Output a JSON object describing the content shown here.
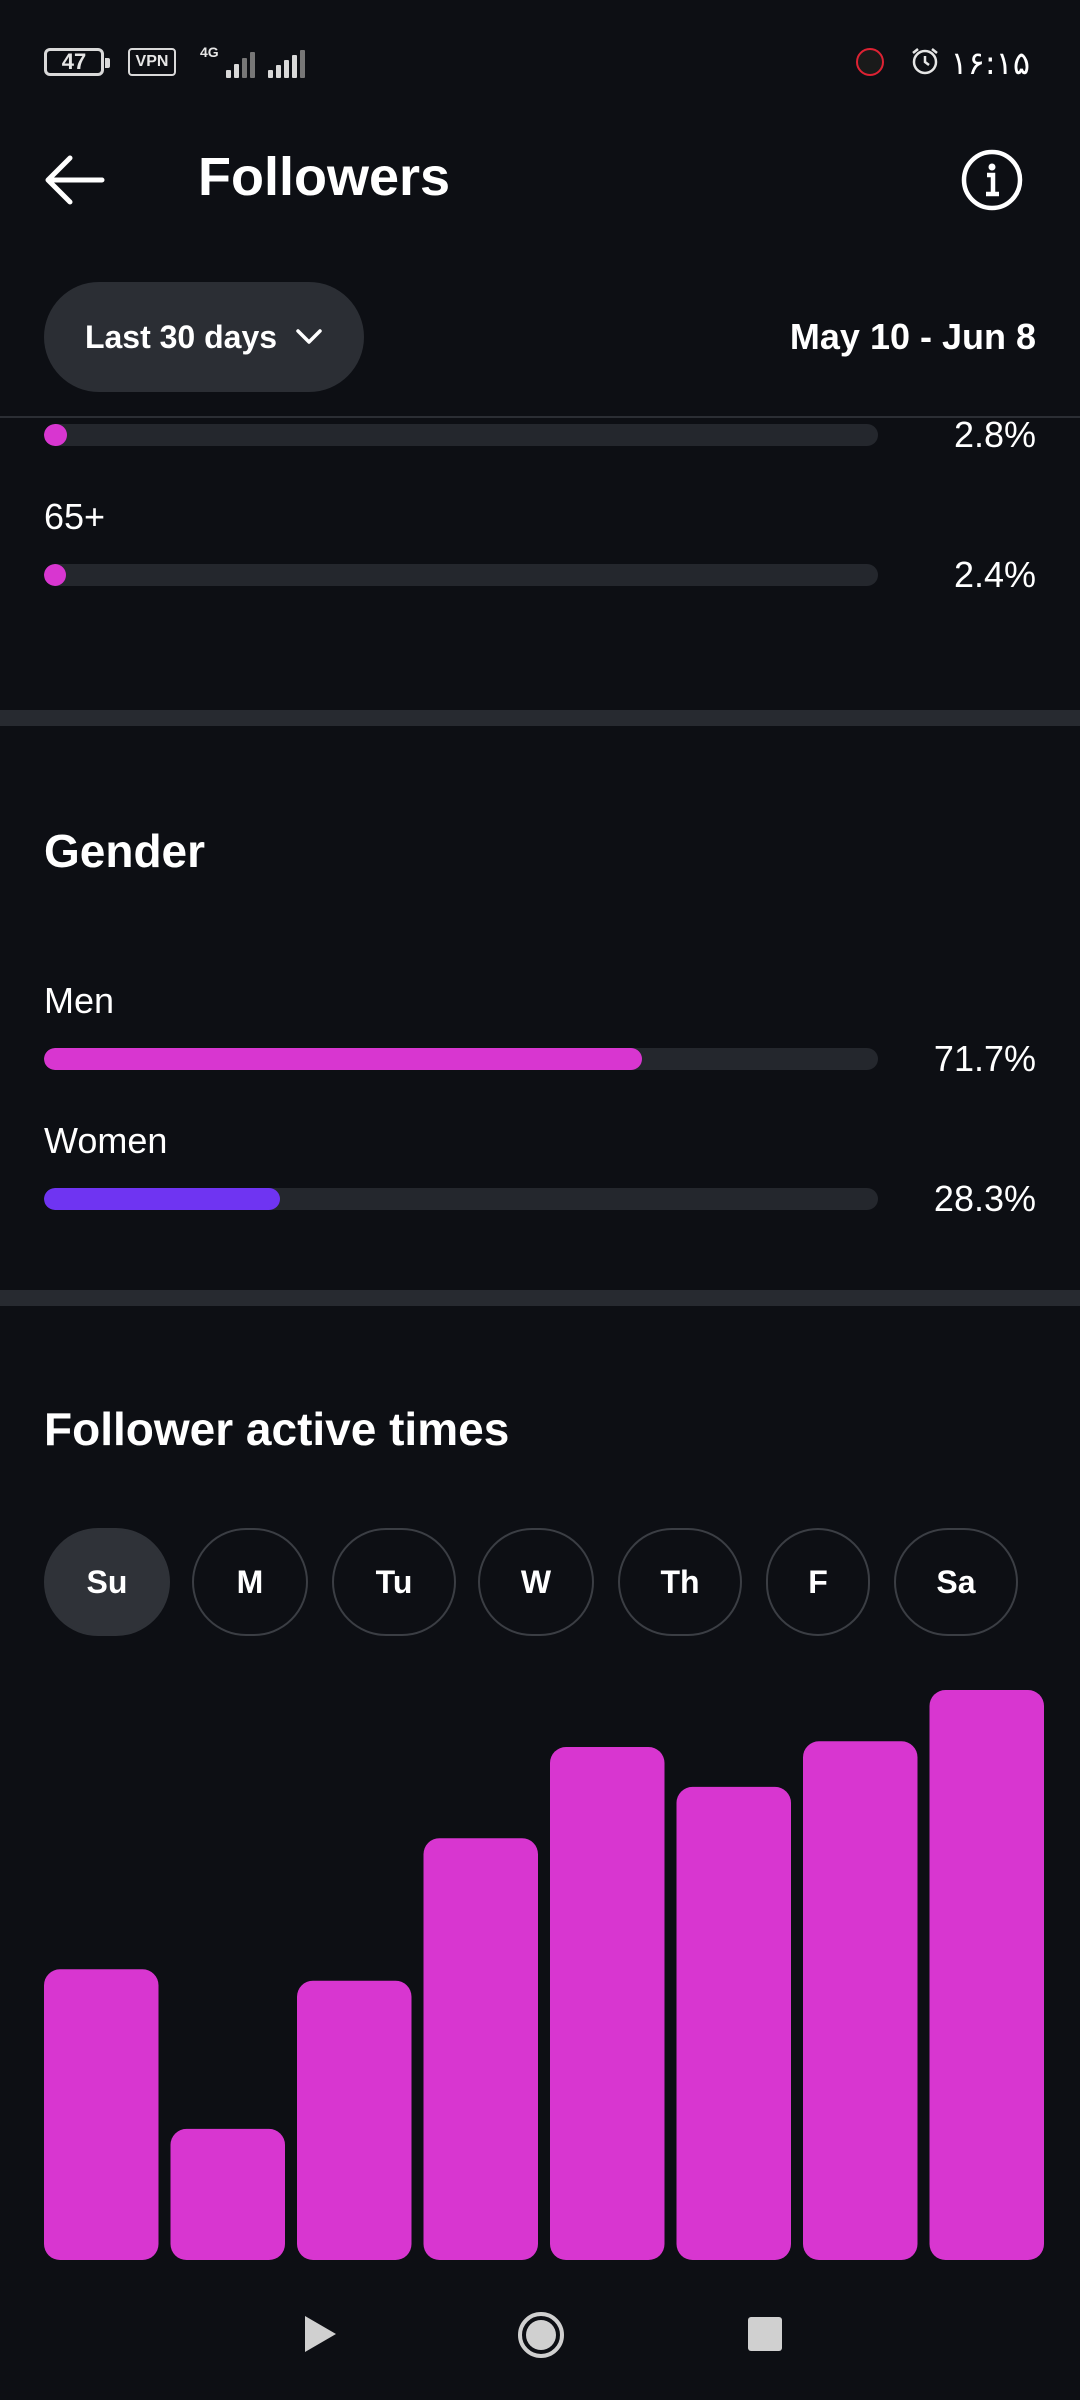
{
  "status_bar": {
    "battery": "47",
    "vpn": "VPN",
    "network": "4G",
    "time": "۱۶:۱۵"
  },
  "header": {
    "title": "Followers"
  },
  "filter": {
    "range_label": "Last 30 days",
    "date_range": "May 10 - Jun 8"
  },
  "age": {
    "rows": [
      {
        "label": "",
        "percent_text": "2.8%",
        "fraction": 0.028
      },
      {
        "label": "65+",
        "percent_text": "2.4%",
        "fraction": 0.024
      }
    ]
  },
  "gender": {
    "title": "Gender",
    "rows": [
      {
        "label": "Men",
        "percent_text": "71.7%",
        "fraction": 0.717,
        "color": "#d836d0"
      },
      {
        "label": "Women",
        "percent_text": "28.3%",
        "fraction": 0.283,
        "color": "#6f34f2"
      }
    ]
  },
  "active_times": {
    "title": "Follower active times",
    "days": [
      "Su",
      "M",
      "Tu",
      "W",
      "Th",
      "F",
      "Sa"
    ],
    "selected_day": "Su"
  },
  "chart_data": {
    "type": "bar",
    "categories": [
      "",
      "",
      "",
      "",
      "",
      "",
      "",
      ""
    ],
    "values": [
      51,
      23,
      49,
      74,
      90,
      83,
      91,
      100
    ],
    "ylim": [
      0,
      100
    ],
    "color": "#d836d0",
    "grid": false
  },
  "colors": {
    "background": "#0d0f14",
    "accent_pink": "#d836d0",
    "accent_purple": "#6f34f2",
    "track": "#24272d"
  }
}
